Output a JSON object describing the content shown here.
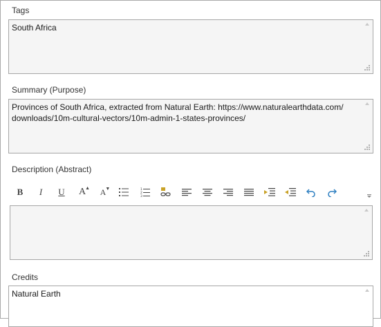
{
  "tags": {
    "label": "Tags",
    "value": "South Africa"
  },
  "summary": {
    "label": "Summary (Purpose)",
    "value": "Provinces of South Africa, extracted from Natural Earth: https://www.naturalearthdata.com/\ndownloads/10m-cultural-vectors/10m-admin-1-states-provinces/"
  },
  "description": {
    "label": "Description (Abstract)",
    "value": "",
    "toolbar": [
      {
        "name": "bold-button",
        "icon": "bold-icon",
        "glyph": "B"
      },
      {
        "name": "italic-button",
        "icon": "italic-icon",
        "glyph": "I"
      },
      {
        "name": "underline-button",
        "icon": "underline-icon",
        "glyph": "U"
      },
      {
        "name": "increase-font-size-button",
        "icon": "increase-font-icon",
        "glyph": "A"
      },
      {
        "name": "decrease-font-size-button",
        "icon": "decrease-font-icon",
        "glyph": "A"
      },
      {
        "name": "bulleted-list-button",
        "icon": "bulleted-list-icon",
        "glyph": ""
      },
      {
        "name": "numbered-list-button",
        "icon": "numbered-list-icon",
        "glyph": ""
      },
      {
        "name": "insert-hyperlink-button",
        "icon": "hyperlink-icon",
        "glyph": ""
      },
      {
        "name": "align-left-button",
        "icon": "align-left-icon",
        "glyph": ""
      },
      {
        "name": "align-center-button",
        "icon": "align-center-icon",
        "glyph": ""
      },
      {
        "name": "align-right-button",
        "icon": "align-right-icon",
        "glyph": ""
      },
      {
        "name": "justify-button",
        "icon": "justify-icon",
        "glyph": ""
      },
      {
        "name": "increase-indent-button",
        "icon": "increase-indent-icon",
        "glyph": ""
      },
      {
        "name": "decrease-indent-button",
        "icon": "decrease-indent-icon",
        "glyph": ""
      },
      {
        "name": "undo-button",
        "icon": "undo-icon",
        "glyph": ""
      },
      {
        "name": "redo-button",
        "icon": "redo-icon",
        "glyph": ""
      }
    ]
  },
  "credits": {
    "label": "Credits",
    "value": "Natural Earth"
  },
  "colors": {
    "accent_blue": "#2d7fc1",
    "link_gold": "#c9a227",
    "border": "#a6a6a6",
    "field_bg": "#f5f5f5"
  }
}
